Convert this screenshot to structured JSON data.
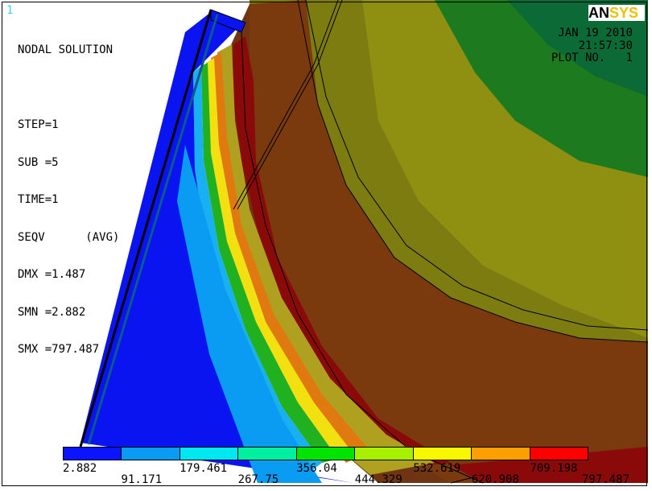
{
  "window_number": "1",
  "logo": {
    "part1": "AN",
    "part2": "SYS"
  },
  "info_lines": [
    "NODAL SOLUTION",
    "",
    "STEP=1",
    "SUB =5",
    "TIME=1",
    "SEQV      (AVG)",
    "DMX =1.487",
    "SMN =2.882",
    "SMX =797.487"
  ],
  "date": "JAN 19 2010",
  "time": "21:57:30",
  "plot_no": "PLOT NO.   1",
  "legend": {
    "colors": [
      "#0a14ff",
      "#0a9bf2",
      "#00e7ef",
      "#00f0a0",
      "#00e400",
      "#a6f000",
      "#f7f700",
      "#fba000",
      "#ff0000"
    ],
    "labels_top": [
      "2.882",
      "179.461",
      "356.04",
      "532.619",
      "709.198"
    ],
    "labels_bottom": [
      "91.171",
      "267.75",
      "444.329",
      "620.908",
      "797.487"
    ]
  },
  "colors": {
    "contour_dark_brown": "#7c3a10",
    "contour_olive": "#8a8a10",
    "contour_green": "#1a7a1a",
    "contour_dark_green": "#0b6a35",
    "contour_blue": "#0a14ff"
  }
}
